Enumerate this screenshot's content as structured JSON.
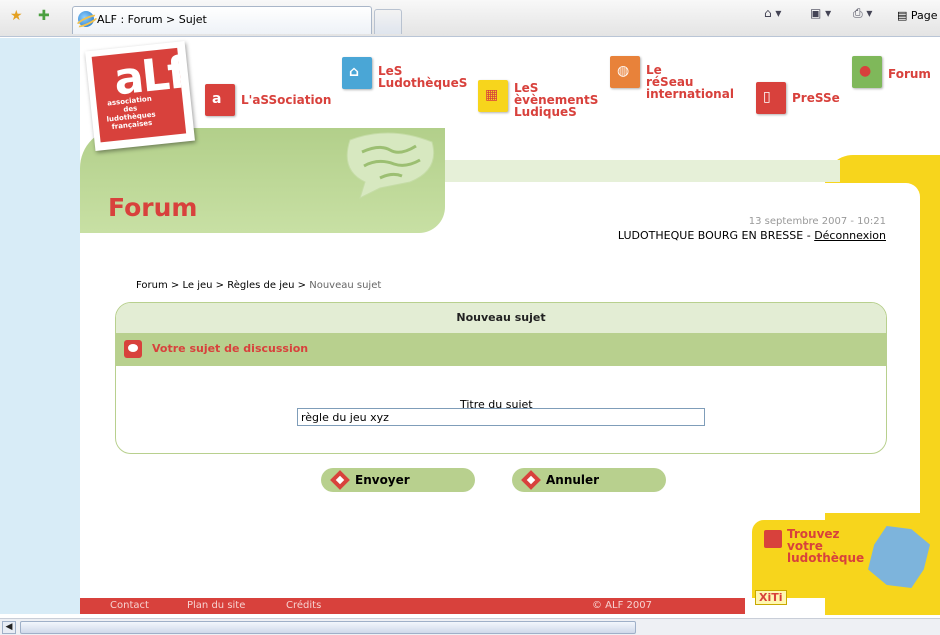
{
  "browser": {
    "tab_title": "ALF : Forum > Sujet",
    "page_menu": "Page"
  },
  "logo": {
    "letters": "aLf",
    "subtitle": "association des ludothèques françaises"
  },
  "nav": [
    {
      "label": "L'aSSociation",
      "color": "#d8413c"
    },
    {
      "label": "LeS\nLudothèqueS",
      "color": "#4aa6d6"
    },
    {
      "label": "LeS\nèvènementS\nLudiqueS",
      "color": "#f7d51c"
    },
    {
      "label": "Le\nréSeau\ninternational",
      "color": "#e8823a"
    },
    {
      "label": "PreSSe",
      "color": "#d8413c"
    },
    {
      "label": "Forum",
      "color": "#7fb85a"
    }
  ],
  "page": {
    "title": "Forum",
    "date": "13 septembre 2007 - 10:21",
    "user": "LUDOTHEQUE BOURG EN BRESSE - ",
    "logout": "Déconnexion"
  },
  "breadcrumb": {
    "items": [
      "Forum",
      "Le jeu",
      "Règles de jeu"
    ],
    "separator": " > ",
    "current": "Nouveau sujet"
  },
  "form": {
    "heading": "Nouveau sujet",
    "section": "Votre sujet de discussion",
    "field_label": "Titre du sujet",
    "field_value": "règle du jeu xyz",
    "send": "Envoyer",
    "cancel": "Annuler"
  },
  "footer": {
    "contact": "Contact",
    "plan": "Plan du site",
    "credits": "Crédits",
    "copyright": "© ALF 2007"
  },
  "finder": {
    "text": "Trouvez\nvotre\nludothèque",
    "badge": "XiTi"
  }
}
